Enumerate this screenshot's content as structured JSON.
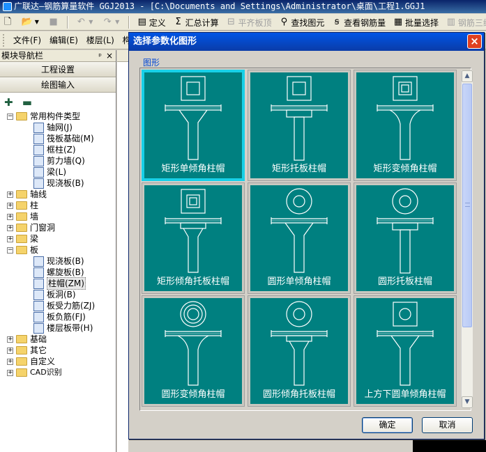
{
  "app": {
    "title": "广联达—钢筋算量软件 GGJ2013 - [C:\\Documents and Settings\\Administrator\\桌面\\工程1.GGJ1"
  },
  "toolbar1": {
    "define_label": "定义",
    "sum_calc_label": "汇总计算",
    "flat_top_label": "平齐板顶",
    "find_element_label": "查找图元",
    "view_rebar_label": "查看钢筋量",
    "batch_select_label": "批量选择",
    "rebar_3d_label": "钢筋三维"
  },
  "menubar": {
    "items": [
      "文件(F)",
      "编辑(E)",
      "楼层(L)",
      "构"
    ]
  },
  "nav": {
    "title": "模块导航栏",
    "pin": "ᵖ",
    "close": "×",
    "tabs": [
      "工程设置",
      "绘图输入"
    ],
    "tools": "✚ ▬",
    "tree": [
      {
        "type": "folder",
        "expander": "−",
        "label": "常用构件类型"
      },
      {
        "type": "child",
        "label": "轴网(J)"
      },
      {
        "type": "child",
        "label": "筏板基础(M)"
      },
      {
        "type": "child",
        "label": "框柱(Z)"
      },
      {
        "type": "child",
        "label": "剪力墙(Q)"
      },
      {
        "type": "child",
        "label": "梁(L)"
      },
      {
        "type": "child",
        "label": "现浇板(B)"
      },
      {
        "type": "folder",
        "expander": "+",
        "label": "轴线"
      },
      {
        "type": "folder",
        "expander": "+",
        "label": "柱"
      },
      {
        "type": "folder",
        "expander": "+",
        "label": "墙"
      },
      {
        "type": "folder",
        "expander": "+",
        "label": "门窗洞"
      },
      {
        "type": "folder",
        "expander": "+",
        "label": "梁"
      },
      {
        "type": "folder",
        "expander": "−",
        "label": "板"
      },
      {
        "type": "child",
        "label": "现浇板(B)"
      },
      {
        "type": "child",
        "label": "螺旋板(B)"
      },
      {
        "type": "child",
        "label": "柱帽(ZM)",
        "selected": true
      },
      {
        "type": "child",
        "label": "板洞(B)"
      },
      {
        "type": "child",
        "label": "板受力筋(ZJ)"
      },
      {
        "type": "child",
        "label": "板负筋(FJ)"
      },
      {
        "type": "child",
        "label": "楼层板带(H)"
      },
      {
        "type": "folder",
        "expander": "+",
        "label": "基础"
      },
      {
        "type": "folder",
        "expander": "+",
        "label": "其它"
      },
      {
        "type": "folder",
        "expander": "+",
        "label": "自定义"
      },
      {
        "type": "folder",
        "expander": "+",
        "label": "CAD识别"
      }
    ]
  },
  "dialog": {
    "title": "选择参数化图形",
    "close": "×",
    "group_label": "图形",
    "shapes": [
      {
        "label": "矩形单倾角柱帽",
        "top": "square",
        "stem": "taper",
        "selected": true
      },
      {
        "label": "矩形托板柱帽",
        "top": "square",
        "stem": "plate"
      },
      {
        "label": "矩形变倾角柱帽",
        "top": "square",
        "stem": "vartaper"
      },
      {
        "label": "矩形倾角托板柱帽",
        "top": "square",
        "stem": "taperplate"
      },
      {
        "label": "圆形单倾角柱帽",
        "top": "circle",
        "stem": "taper"
      },
      {
        "label": "圆形托板柱帽",
        "top": "circle",
        "stem": "plate"
      },
      {
        "label": "圆形变倾角柱帽",
        "top": "circle",
        "stem": "vartaper"
      },
      {
        "label": "圆形倾角托板柱帽",
        "top": "circle",
        "stem": "taperplate"
      },
      {
        "label": "上方下圆单倾角柱帽",
        "top": "squarecircle",
        "stem": "taper"
      }
    ],
    "ok_label": "确定",
    "cancel_label": "取消",
    "scroll_up": "▲",
    "scroll_down": "▼"
  },
  "colors": {
    "thumb_bg": "#008080",
    "selected_border": "#18d0e8",
    "title_bar": "#0055e5"
  }
}
